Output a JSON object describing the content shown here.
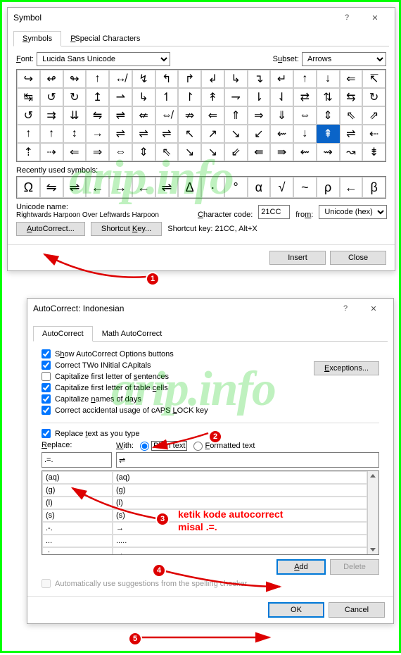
{
  "symbol_dialog": {
    "title": "Symbol",
    "tabs": {
      "symbols": "Symbols",
      "special": "Special Characters"
    },
    "font_label": "Font:",
    "font_value": "Lucida Sans Unicode",
    "subset_label": "Subset:",
    "subset_value": "Arrows",
    "grid": [
      "↪",
      "↫",
      "↬",
      "↑",
      "↮",
      "↯",
      "↰",
      "↱",
      "↲",
      "↳",
      "↴",
      "↵",
      "↑",
      "↓",
      "⇐",
      "↸",
      "↹",
      "↺",
      "↻",
      "↥",
      "⇀",
      "↳",
      "↿",
      "↾",
      "↟",
      "⇁",
      "⇂",
      "⇃",
      "⇄",
      "⇅",
      "⇆",
      "↻",
      "↺",
      "⇉",
      "⇊",
      "⇋",
      "⇌",
      "⇍",
      "⇎",
      "⇏",
      "⇐",
      "⇑",
      "⇒",
      "⇓",
      "⇔",
      "⇕",
      "⇖",
      "⇗",
      "↑",
      "↑",
      "↕",
      "→",
      "⇌",
      "⇌",
      "⇌",
      "↖",
      "↗",
      "↘",
      "↙",
      "⇜",
      "↓",
      "⇞",
      "⇌",
      "⇠",
      "⇡",
      "⇢",
      "⇐",
      "⇒",
      "⇔",
      "⇕",
      "⇖",
      "↘",
      "↘",
      "⇙",
      "⇚",
      "⇛",
      "⇜",
      "⇝",
      "↝",
      "⇟"
    ],
    "selected_index": 61,
    "recent_label": "Recently used symbols:",
    "recent": [
      "Ω",
      "⇋",
      "⇌",
      "←",
      "→",
      "←",
      "⇌",
      "Δ",
      "·",
      "°",
      "α",
      "√",
      "~",
      "ρ",
      "←",
      "β"
    ],
    "unicode_name_label": "Unicode name:",
    "unicode_name": "Rightwards Harpoon Over Leftwards Harpoon",
    "char_code_label": "Character code:",
    "char_code": "21CC",
    "from_label": "from:",
    "from_value": "Unicode (hex)",
    "autocorrect_btn": "AutoCorrect...",
    "shortcut_btn": "Shortcut Key...",
    "shortcut_text": "Shortcut key: 21CC, Alt+X",
    "insert_btn": "Insert",
    "close_btn": "Close"
  },
  "autocorrect_dialog": {
    "title": "AutoCorrect: Indonesian",
    "tabs": {
      "ac": "AutoCorrect",
      "math": "Math AutoCorrect"
    },
    "opts": {
      "show": "Show AutoCorrect Options buttons",
      "two": "Correct TWo INitial CApitals",
      "sent": "Capitalize first letter of sentences",
      "table": "Capitalize first letter of table cells",
      "days": "Capitalize names of days",
      "caps": "Correct accidental usage of cAPS LOCK key"
    },
    "exceptions_btn": "Exceptions...",
    "replace_chk": "Replace text as you type",
    "replace_label": "Replace:",
    "with_label": "With:",
    "plain_label": "Plain text",
    "formatted_label": "Formatted text",
    "replace_val": ".=.",
    "with_val": "⇌",
    "rows": [
      {
        "r": "(aq)",
        "w": "(aq)"
      },
      {
        "r": "(g)",
        "w": "(g)"
      },
      {
        "r": "(l)",
        "w": "(l)"
      },
      {
        "r": "(s)",
        "w": "(s)"
      },
      {
        "r": ".-.",
        "w": "→"
      },
      {
        "r": "...",
        "w": "....."
      },
      {
        "r": ".:.",
        "w": "→"
      }
    ],
    "add_btn": "Add",
    "delete_btn": "Delete",
    "auto_spell": "Automatically use suggestions from the spelling checker",
    "ok_btn": "OK",
    "cancel_btn": "Cancel"
  },
  "annotation": {
    "line1": "ketik kode autocorrect",
    "line2": "misal .=."
  },
  "watermark": "arip.info"
}
